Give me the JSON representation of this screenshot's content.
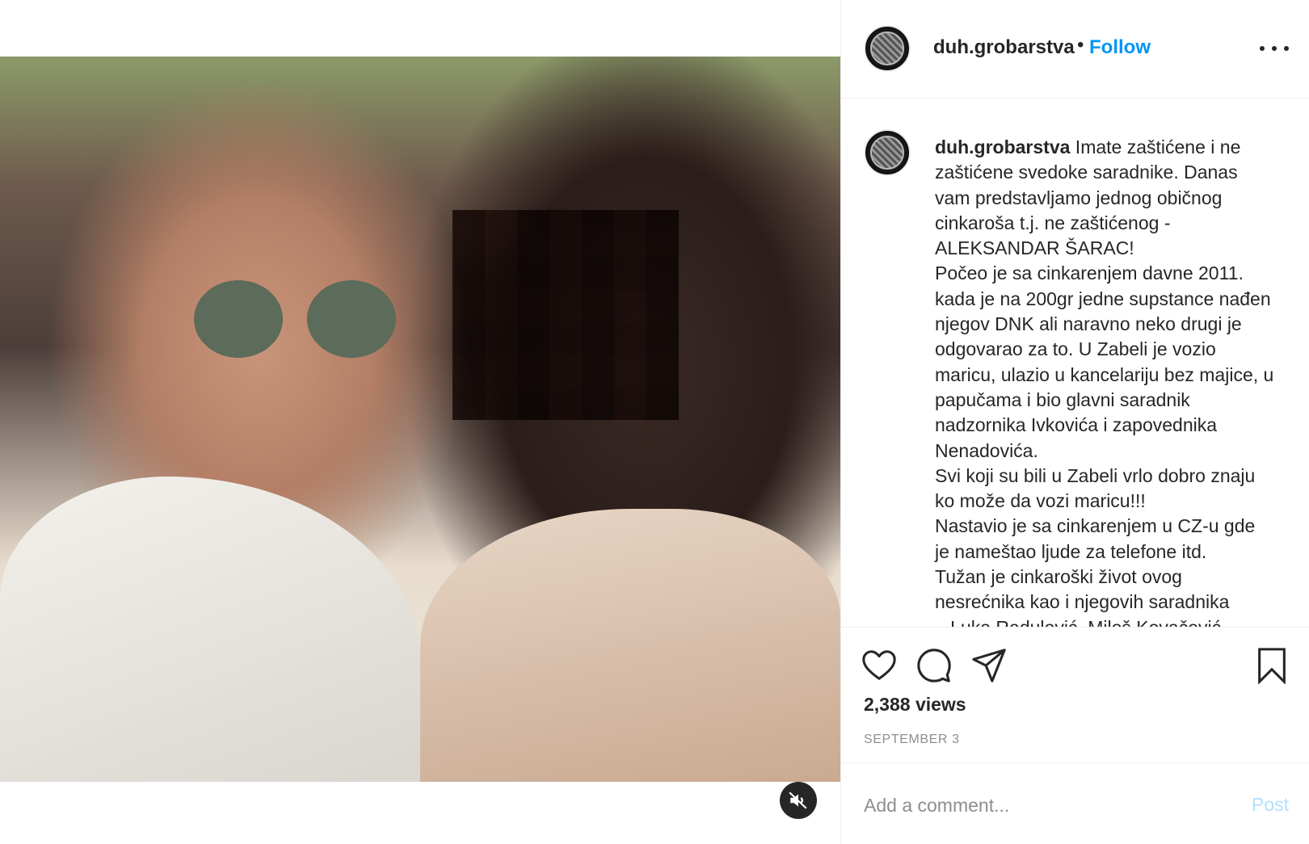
{
  "header": {
    "username": "duh.grobarstva",
    "separator": "•",
    "follow_label": "Follow",
    "more_icon": "more-horizontal-icon"
  },
  "caption": {
    "username": "duh.grobarstva",
    "text": " Imate zaštićene i ne zaštićene svedoke saradnike. Danas vam predstavljamo jednog običnog cinkaroša t.j. ne zaštićenog - ALEKSANDAR ŠARAC!\nPočeo je sa cinkarenjem davne 2011. kada je na 200gr jedne supstance nađen njegov DNK ali naravno neko drugi je odgovarao za to. U Zabeli je vozio maricu, ulazio u kancelariju bez majice, u papučama i bio glavni saradnik nadzornika Ivkovića i zapovednika Nenadovića.\nSvi koji su bili u Zabeli vrlo dobro znaju ko može da vozi maricu!!!\nNastavio je sa cinkarenjem u CZ-u gde je nameštao ljude za telefone itd.\nTužan je cinkaroški život ovog nesrećnika kao i njegovih saradnika ...Luka Radulović, Miloš Kovačević"
  },
  "actions": {
    "like_icon": "heart-icon",
    "comment_icon": "comment-icon",
    "share_icon": "share-icon",
    "save_icon": "bookmark-icon"
  },
  "stats": {
    "views": "2,388 views",
    "date": "SEPTEMBER 3"
  },
  "comment": {
    "placeholder": "Add a comment...",
    "post_label": "Post"
  },
  "media": {
    "mute_icon": "speaker-muted-icon"
  },
  "colors": {
    "accent": "#0095f6",
    "post_disabled": "#b2dffc",
    "text": "#262626",
    "muted": "#8e8e8e",
    "border": "#efefef"
  }
}
